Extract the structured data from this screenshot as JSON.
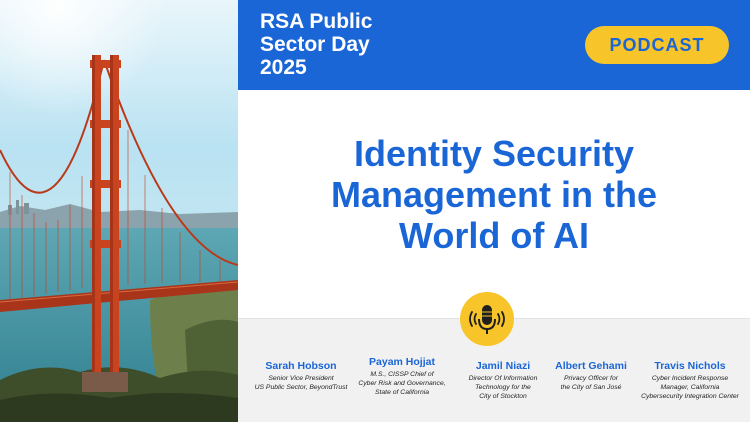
{
  "header": {
    "event_title": "RSA Public\nSector Day\n2025",
    "badge_label": "PODCAST"
  },
  "main": {
    "title": "Identity Security\nManagement in the\nWorld of AI"
  },
  "icons": {
    "podcast": "microphone-icon"
  },
  "speakers": [
    {
      "name": "Sarah Hobson",
      "role": "Senior Vice President\nUS Public Sector, BeyondTrust"
    },
    {
      "name": "Payam Hojjat",
      "role": "M.S., CISSP Chief of\nCyber Risk and Governance,\nState of California"
    },
    {
      "name": "Jamil Niazi",
      "role": "Director Of Information\nTechnology for the\nCity of Stockton"
    },
    {
      "name": "Albert Gehami",
      "role": "Privacy Officer for\nthe City of San José"
    },
    {
      "name": "Travis Nichols",
      "role": "Cyber Incident Response\nManager, California\nCybersecurity Integration Center"
    }
  ],
  "colors": {
    "brand_blue": "#1a66d6",
    "accent_yellow": "#f7c52a",
    "bridge_orange": "#c9431f",
    "sky": "#9fd3ea",
    "sea": "#3f8fa3"
  }
}
